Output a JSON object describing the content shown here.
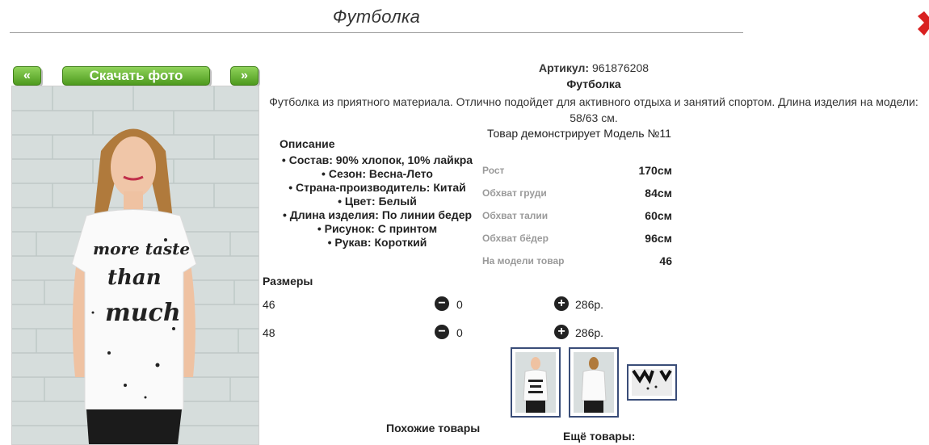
{
  "page": {
    "title": "Футболка"
  },
  "gallery": {
    "prev_label": "«",
    "download_label": "Скачать фото",
    "next_label": "»"
  },
  "product": {
    "article_label": "Артикул:",
    "article_value": "961876208",
    "name": "Футболка",
    "description": "Футболка из приятного материала. Отлично подойдет для активного отдыха и занятий спортом. Длина изделия на модели: 58/63 см.",
    "demo_text": "Товар демонстрирует Модель №11"
  },
  "specs": {
    "heading": "Описание",
    "items": [
      "Состав: 90% хлопок, 10% лайкра",
      "Сезон: Весна-Лето",
      "Страна-производитель: Китай",
      "Цвет: Белый",
      "Длина изделия: По линии бедер",
      "Рисунок: С принтом",
      "Рукав: Короткий"
    ]
  },
  "model": {
    "rows": [
      {
        "label": "Рост",
        "value": "170см"
      },
      {
        "label": "Обхват груди",
        "value": "84см"
      },
      {
        "label": "Обхват талии",
        "value": "60см"
      },
      {
        "label": "Обхват бёдер",
        "value": "96см"
      },
      {
        "label": "На модели товар",
        "value": "46"
      }
    ]
  },
  "sizes": {
    "heading": "Размеры",
    "rows": [
      {
        "size": "46",
        "qty": "0",
        "price": "286р."
      },
      {
        "size": "48",
        "qty": "0",
        "price": "286р."
      }
    ]
  },
  "footer": {
    "similar_label": "Похожие товары",
    "more_label": "Ещё товары:"
  },
  "colors": {
    "button_green": "#5aa827",
    "thumb_border": "#3a4d78",
    "corner_red": "#d92020"
  },
  "icons": {
    "minus": "minus-circle-icon",
    "plus": "plus-circle-icon",
    "corner": "red-arrow-icon"
  }
}
